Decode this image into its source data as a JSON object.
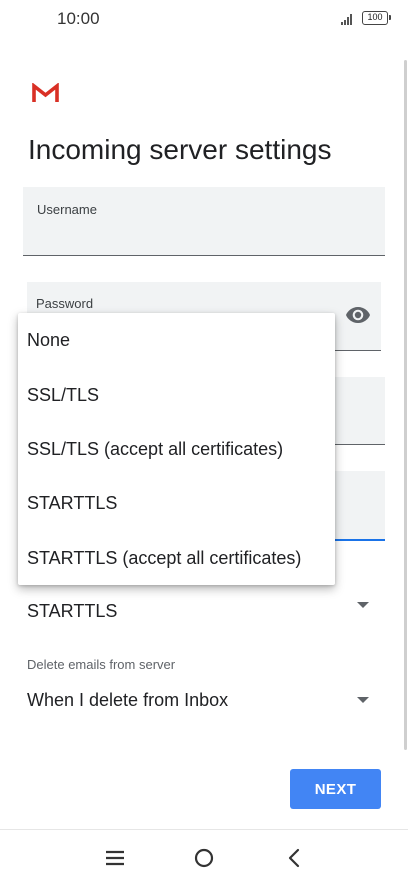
{
  "status_bar": {
    "time": "10:00",
    "battery": "100"
  },
  "header": {
    "logo_icon": "gmail-logo-icon",
    "title": "Incoming server settings"
  },
  "form": {
    "username_label": "Username",
    "password_label": "Password",
    "password_toggle_icon": "eye-icon",
    "security_type_value": "STARTTLS",
    "delete_label": "Delete emails from server",
    "delete_value": "When I delete from Inbox"
  },
  "dropdown": {
    "options": [
      "None",
      "SSL/TLS",
      "SSL/TLS (accept all certificates)",
      "STARTTLS",
      "STARTTLS (accept all certificates)"
    ]
  },
  "actions": {
    "next_label": "NEXT"
  },
  "nav": {
    "icons": [
      "menu-icon",
      "home-icon",
      "back-icon"
    ]
  },
  "colors": {
    "accent": "#4285f4",
    "field_background": "#f1f3f4",
    "focus_underline": "#1a73e8",
    "gmail_red": "#d93025"
  }
}
